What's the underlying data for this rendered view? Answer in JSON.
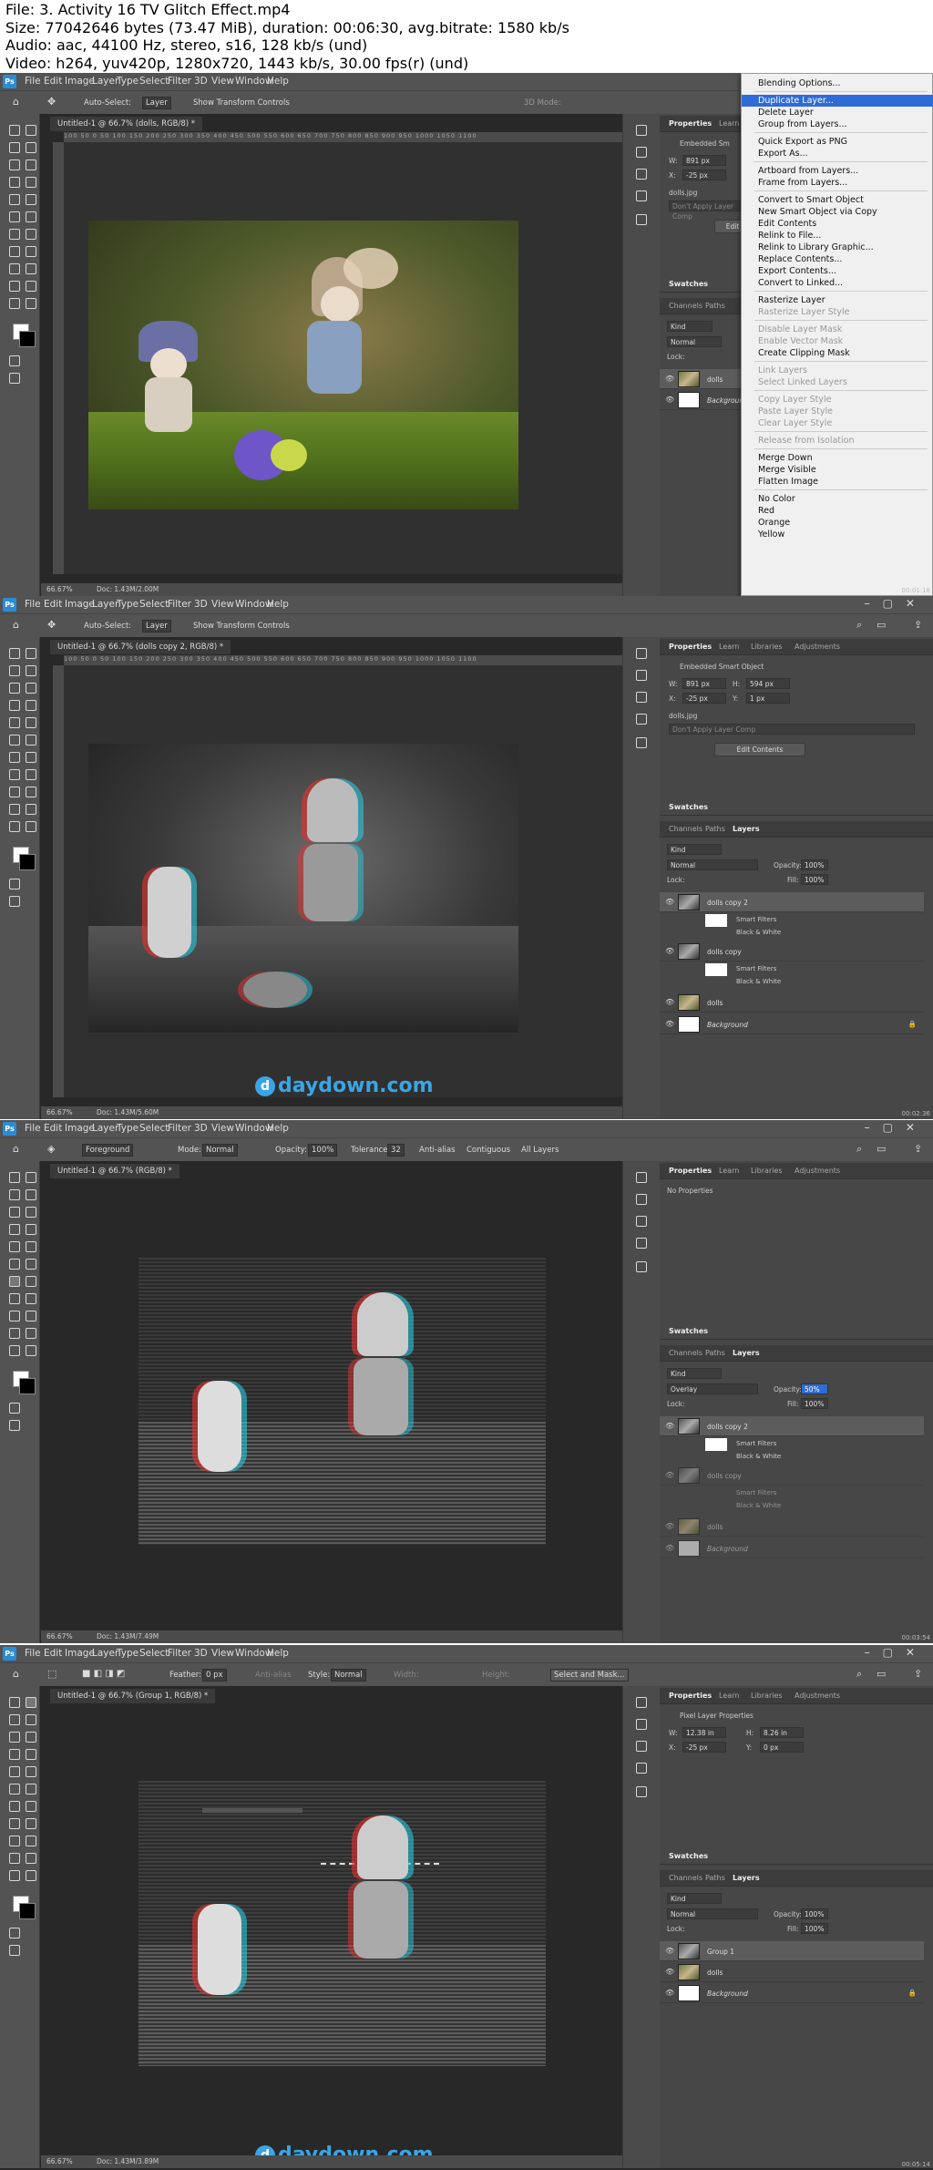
{
  "header": {
    "lines": [
      "File: 3. Activity 16 TV Glitch Effect.mp4",
      "Size: 77042646 bytes (73.47 MiB), duration: 00:06:30, avg.bitrate: 1580 kb/s",
      "Audio: aac, 44100 Hz, stereo, s16, 128 kb/s (und)",
      "Video: h264, yuv420p, 1280x720, 1443 kb/s, 30.00 fps(r) (und)"
    ]
  },
  "menu": [
    "File",
    "Edit",
    "Image",
    "Layer",
    "Type",
    "Select",
    "Filter",
    "3D",
    "View",
    "Window",
    "Help"
  ],
  "ps_logo": "Ps",
  "f1": {
    "options": {
      "auto_select": "Auto-Select:",
      "target": "Layer",
      "transform": "Show Transform Controls",
      "mode3d": "3D Mode:"
    },
    "tab": "Untitled-1 @ 66.7% (dolls, RGB/8) *",
    "status_zoom": "66.67%",
    "status_doc": "Doc: 1.43M/2.00M",
    "props_tabs": [
      "Properties",
      "Learn"
    ],
    "embedded": "Embedded Sm",
    "w_label": "W:",
    "w_value": "891 px",
    "x_label": "X:",
    "x_value": "-25 px",
    "file": "dolls.jpg",
    "layer_comp": "Don't Apply Layer Comp",
    "edit_btn": "Edit",
    "swatches": "Swatches",
    "tabs2": [
      "Channels",
      "Paths"
    ],
    "kind": "Kind",
    "blend": "Normal",
    "lock": "Lock:",
    "layers": [
      {
        "name": "dolls"
      },
      {
        "name": "Background"
      }
    ],
    "context_menu": {
      "items": [
        {
          "label": "Blending Options...",
          "state": "normal"
        },
        {
          "label": "Duplicate Layer...",
          "state": "highlight"
        },
        {
          "label": "Delete Layer",
          "state": "normal"
        },
        {
          "label": "Group from Layers...",
          "state": "normal"
        },
        {
          "label": "Quick Export as PNG",
          "state": "normal"
        },
        {
          "label": "Export As...",
          "state": "normal"
        },
        {
          "label": "Artboard from Layers...",
          "state": "normal"
        },
        {
          "label": "Frame from Layers...",
          "state": "normal"
        },
        {
          "label": "Convert to Smart Object",
          "state": "normal"
        },
        {
          "label": "New Smart Object via Copy",
          "state": "normal"
        },
        {
          "label": "Edit Contents",
          "state": "normal"
        },
        {
          "label": "Relink to File...",
          "state": "normal"
        },
        {
          "label": "Relink to Library Graphic...",
          "state": "normal"
        },
        {
          "label": "Replace Contents...",
          "state": "normal"
        },
        {
          "label": "Export Contents...",
          "state": "normal"
        },
        {
          "label": "Convert to Linked...",
          "state": "normal"
        },
        {
          "label": "Rasterize Layer",
          "state": "normal"
        },
        {
          "label": "Rasterize Layer Style",
          "state": "disabled"
        },
        {
          "label": "Disable Layer Mask",
          "state": "disabled"
        },
        {
          "label": "Enable Vector Mask",
          "state": "disabled"
        },
        {
          "label": "Create Clipping Mask",
          "state": "normal"
        },
        {
          "label": "Link Layers",
          "state": "disabled"
        },
        {
          "label": "Select Linked Layers",
          "state": "disabled"
        },
        {
          "label": "Copy Layer Style",
          "state": "disabled"
        },
        {
          "label": "Paste Layer Style",
          "state": "disabled"
        },
        {
          "label": "Clear Layer Style",
          "state": "disabled"
        },
        {
          "label": "Release from Isolation",
          "state": "disabled"
        },
        {
          "label": "Merge Down",
          "state": "normal"
        },
        {
          "label": "Merge Visible",
          "state": "normal"
        },
        {
          "label": "Flatten Image",
          "state": "normal"
        },
        {
          "label": "No Color",
          "state": "normal"
        },
        {
          "label": "Red",
          "state": "normal"
        },
        {
          "label": "Orange",
          "state": "normal"
        },
        {
          "label": "Yellow",
          "state": "normal"
        }
      ]
    },
    "timestamp": "00:01:18"
  },
  "f2": {
    "options": {
      "auto_select": "Auto-Select:",
      "target": "Layer",
      "transform": "Show Transform Controls"
    },
    "tab": "Untitled-1 @ 66.7% (dolls copy 2, RGB/8) *",
    "status_zoom": "66.67%",
    "status_doc": "Doc: 1.43M/5.60M",
    "props_tabs": [
      "Properties",
      "Learn",
      "Libraries",
      "Adjustments"
    ],
    "embedded": "Embedded Smart Object",
    "w_label": "W:",
    "w_value": "891 px",
    "h_label": "H:",
    "h_value": "594 px",
    "x_label": "X:",
    "x_value": "-25 px",
    "y_label": "Y:",
    "y_value": "1 px",
    "file": "dolls.jpg",
    "layer_comp": "Don't Apply Layer Comp",
    "edit_btn": "Edit Contents",
    "swatches": "Swatches",
    "tabs2": [
      "Channels",
      "Paths",
      "Layers"
    ],
    "kind": "Kind",
    "blend": "Normal",
    "opacity_label": "Opacity:",
    "opacity": "100%",
    "lock": "Lock:",
    "fill_label": "Fill:",
    "fill": "100%",
    "layers": [
      {
        "name": "dolls copy 2",
        "smart": "Smart Filters",
        "filter": "Black & White"
      },
      {
        "name": "dolls copy",
        "smart": "Smart Filters",
        "filter": "Black & White"
      },
      {
        "name": "dolls"
      },
      {
        "name": "Background"
      }
    ],
    "timestamp": "00:02:36"
  },
  "f3": {
    "options": {
      "fg": "Foreground",
      "mode_label": "Mode:",
      "mode": "Normal",
      "opacity_label": "Opacity:",
      "opacity": "100%",
      "tol_label": "Tolerance:",
      "tolerance": "32",
      "anti": "Anti-alias",
      "contig": "Contiguous",
      "all": "All Layers"
    },
    "tab": "Untitled-1 @ 66.7% (RGB/8) *",
    "status_zoom": "66.67%",
    "status_doc": "Doc: 1.43M/7.49M",
    "props_tabs": [
      "Properties",
      "Learn",
      "Libraries",
      "Adjustments"
    ],
    "no_props": "No Properties",
    "swatches": "Swatches",
    "tabs2": [
      "Channels",
      "Paths",
      "Layers"
    ],
    "kind": "Kind",
    "blend": "Overlay",
    "opacity_label": "Opacity:",
    "opacity": "50%",
    "lock": "Lock:",
    "fill_label": "Fill:",
    "fill": "100%",
    "layers": [
      {
        "name": "dolls copy 2",
        "smart": "Smart Filters",
        "filter": "Black & White"
      },
      {
        "name": "dolls copy",
        "smart": "Smart Filters",
        "filter": "Black & White"
      },
      {
        "name": "dolls"
      },
      {
        "name": "Background"
      }
    ],
    "timestamp": "00:03:54"
  },
  "f4": {
    "options": {
      "feather_label": "Feather:",
      "feather": "0 px",
      "anti": "Anti-alias",
      "style_label": "Style:",
      "style": "Normal",
      "width": "Width:",
      "height": "Height:",
      "mask_btn": "Select and Mask..."
    },
    "tab": "Untitled-1 @ 66.7% (Group 1, RGB/8) *",
    "status_zoom": "66.67%",
    "status_doc": "Doc: 1.43M/3.89M",
    "props_tabs": [
      "Properties",
      "Learn",
      "Libraries",
      "Adjustments"
    ],
    "pixel_props": "Pixel Layer Properties",
    "w_label": "W:",
    "w_value": "12.38 in",
    "h_label": "H:",
    "h_value": "8.26 in",
    "x_label": "X:",
    "x_value": "-25 px",
    "y_label": "Y:",
    "y_value": "0 px",
    "swatches": "Swatches",
    "tabs2": [
      "Channels",
      "Paths",
      "Layers"
    ],
    "kind": "Kind",
    "blend": "Normal",
    "opacity_label": "Opacity:",
    "opacity": "100%",
    "lock": "Lock:",
    "fill_label": "Fill:",
    "fill": "100%",
    "layers": [
      {
        "name": "Group 1"
      },
      {
        "name": "dolls"
      },
      {
        "name": "Background"
      }
    ],
    "timestamp": "00:05:14"
  },
  "watermark": "daydown.com",
  "ruler_ticks": "100    50    0    50   100   150   200   250   300   350   400   450   500   550   600   650   700   750   800   850   900   950   1000  1050 1100"
}
